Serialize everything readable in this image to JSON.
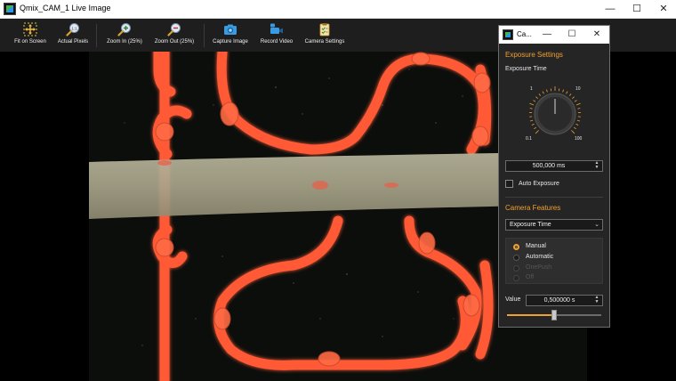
{
  "window": {
    "title": "Qmix_CAM_1 Live Image",
    "minimize_glyph": "—",
    "maximize_glyph": "☐",
    "close_glyph": "✕"
  },
  "toolbar": {
    "fit_on_screen": "Fit on Screen",
    "actual_pixels": "Actual Pixels",
    "zoom_in": "Zoom In (25%)",
    "zoom_out": "Zoom Out (25%)",
    "capture_image": "Capture Image",
    "record_video": "Record Video",
    "camera_settings": "Camera Settings",
    "actual_pixels_badge": "1:1"
  },
  "dialog": {
    "title": "Ca...",
    "exposure_section": "Exposure Settings",
    "exposure_time_label": "Exposure Time",
    "knob_labels": {
      "top_left": "1",
      "top_right": "10",
      "bottom_left": "0.1",
      "bottom_right": "100"
    },
    "knob_level": 0.5,
    "exposure_value": "500,000 ms",
    "auto_exposure_label": "Auto Exposure",
    "auto_exposure_checked": false,
    "camera_features_section": "Camera Features",
    "feature_select": "Exposure Time",
    "modes": [
      {
        "label": "Manual",
        "selected": true,
        "enabled": true
      },
      {
        "label": "Automatic",
        "selected": false,
        "enabled": true
      },
      {
        "label": "OnePush",
        "selected": false,
        "enabled": false
      },
      {
        "label": "Off",
        "selected": false,
        "enabled": false
      }
    ],
    "value_label": "Value",
    "value": "0,500000 s",
    "slider_level": 0.5
  },
  "colors": {
    "accent": "#f0a030",
    "toolbar_bg": "#1e1e1e",
    "dialog_bg": "#252526",
    "channel_red": "#ff5a36"
  }
}
